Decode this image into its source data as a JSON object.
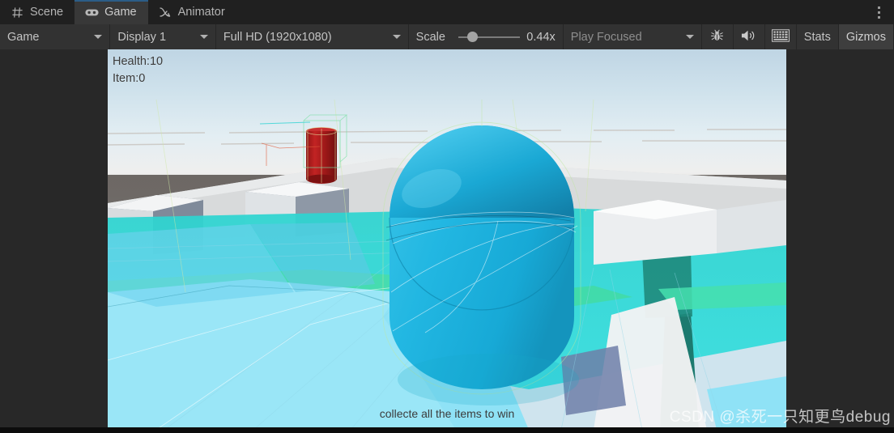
{
  "window": {
    "tabs": [
      {
        "id": "scene",
        "label": "Scene",
        "icon": "grid-icon",
        "active": false
      },
      {
        "id": "game",
        "label": "Game",
        "icon": "gamepad-icon",
        "active": true
      },
      {
        "id": "animator",
        "label": "Animator",
        "icon": "animator-icon",
        "active": false
      }
    ],
    "more_menu": "kebab-menu-icon"
  },
  "toolbar": {
    "view_mode": "Game",
    "display": "Display 1",
    "resolution": "Full HD (1920x1080)",
    "scale_label": "Scale",
    "scale_value": "0.44x",
    "scale_percent": 22,
    "play_mode": "Play Focused",
    "mute_audio_icon": "speaker-icon",
    "debug_icon": "bug-icon",
    "stats_shortcut_icon": "keyboard-icon",
    "stats_label": "Stats",
    "gizmos_label": "Gizmos"
  },
  "game": {
    "hud": {
      "health": "Health:10",
      "item": "Item:0"
    },
    "objective_text": "collecte all the items to win",
    "watermark": "CSDN @杀死一只知更鸟debug"
  },
  "colors": {
    "tab_active_underline": "#2c5d87",
    "panel_bg": "#282828",
    "toolbar_bg": "#323232",
    "player_capsule": "#29b8e0",
    "pickup_cylinder": "#a81c1c",
    "water_light": "#9ae4f5",
    "water_teal": "#2ad6d6",
    "platform_gray": "#d2d4d6",
    "far_ground": "#6e6966"
  }
}
